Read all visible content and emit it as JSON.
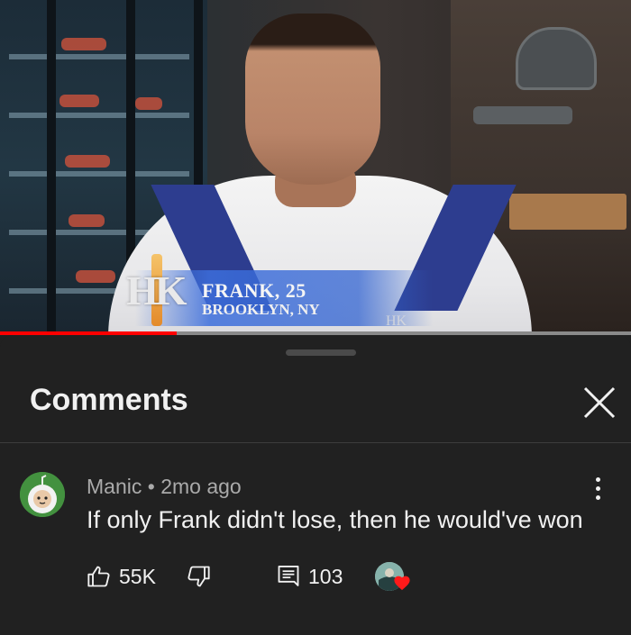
{
  "video": {
    "overlay_name": "FRANK, 25",
    "overlay_location": "BROOKLYN, NY",
    "logo_text": "HK",
    "watermark": "HK",
    "progress_fraction": 0.28,
    "colors": {
      "progress": "#ff0000",
      "banner_blue": "#3c6edc"
    }
  },
  "comments_sheet": {
    "title": "Comments",
    "close_icon": "close-icon"
  },
  "comment": {
    "author": "Manic",
    "separator": "•",
    "time": "2mo ago",
    "text": "If only Frank didn't lose, then he would've won",
    "likes": "55K",
    "replies": "103",
    "icons": {
      "like": "thumbs-up-icon",
      "dislike": "thumbs-down-icon",
      "reply": "reply-icon",
      "more": "more-vert-icon",
      "creator_heart": "heart-icon"
    }
  }
}
